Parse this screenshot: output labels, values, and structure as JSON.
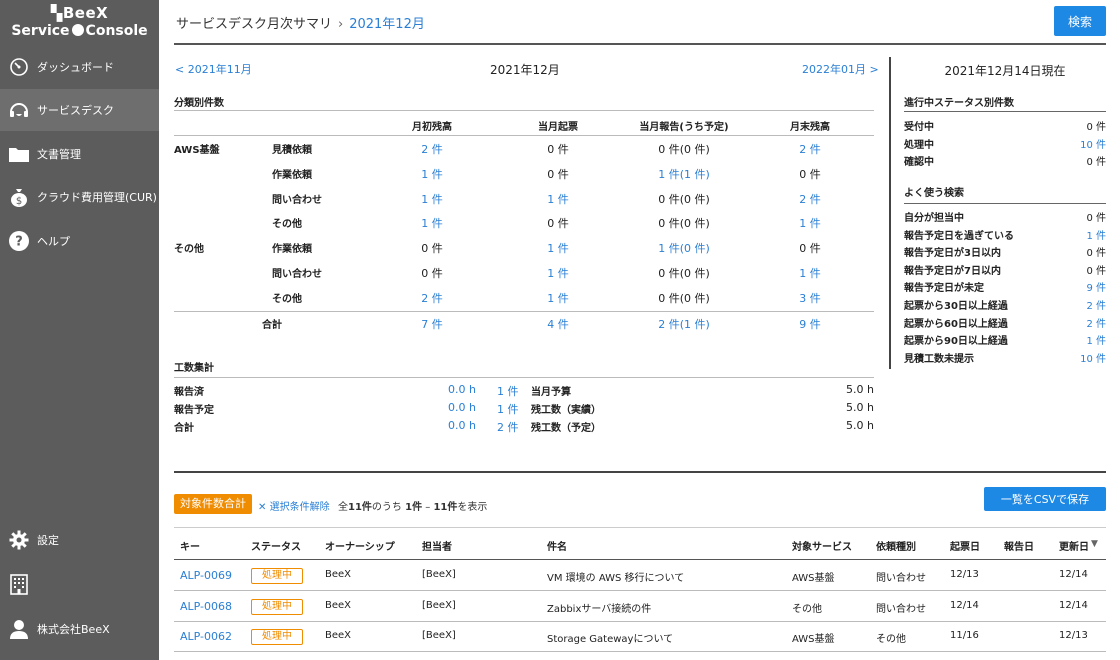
{
  "sidebar": {
    "logo_top": "BeeX",
    "logo_bottom_left": "Service",
    "logo_bottom_right": "Console",
    "items": [
      {
        "label": "ダッシュボード",
        "icon": "dashboard-gauge-icon"
      },
      {
        "label": "サービスデスク",
        "icon": "headset-icon"
      },
      {
        "label": "文書管理",
        "icon": "folder-icon"
      },
      {
        "label": "クラウド費用管理(CUR)",
        "icon": "money-bag-icon"
      },
      {
        "label": "ヘルプ",
        "icon": "help-icon"
      }
    ],
    "bottom_items": [
      {
        "label": "設定",
        "icon": "gear-icon"
      },
      {
        "label": "",
        "icon": "building-icon"
      },
      {
        "label": "株式会社BeeX",
        "icon": "user-icon"
      }
    ]
  },
  "header": {
    "breadcrumb_parent": "サービスデスク月次サマリ",
    "breadcrumb_current": "2021年12月",
    "search_button": "検索"
  },
  "month_nav": {
    "prev": "< 2021年11月",
    "current": "2021年12月",
    "next": "2022年01月 >"
  },
  "category": {
    "title": "分類別件数",
    "columns": [
      "月初残高",
      "当月起票",
      "当月報告(うち予定)",
      "月末残高"
    ],
    "rows": [
      {
        "group": "AWS基盤",
        "type": "見積依頼",
        "c1": "2 件",
        "c2": "0 件",
        "c3": "0 件(0 件)",
        "c4": "2 件"
      },
      {
        "group": "",
        "type": "作業依頼",
        "c1": "1 件",
        "c2": "0 件",
        "c3": "1 件(1 件)",
        "c4": "0 件"
      },
      {
        "group": "",
        "type": "問い合わせ",
        "c1": "1 件",
        "c2": "1 件",
        "c3": "0 件(0 件)",
        "c4": "2 件"
      },
      {
        "group": "",
        "type": "その他",
        "c1": "1 件",
        "c2": "0 件",
        "c3": "0 件(0 件)",
        "c4": "1 件"
      },
      {
        "group": "その他",
        "type": "作業依頼",
        "c1": "0 件",
        "c2": "1 件",
        "c3": "1 件(0 件)",
        "c4": "0 件"
      },
      {
        "group": "",
        "type": "問い合わせ",
        "c1": "0 件",
        "c2": "1 件",
        "c3": "0 件(0 件)",
        "c4": "1 件"
      },
      {
        "group": "",
        "type": "その他",
        "c1": "2 件",
        "c2": "1 件",
        "c3": "0 件(0 件)",
        "c4": "3 件"
      }
    ],
    "total": {
      "label": "合計",
      "c1": "7 件",
      "c2": "4 件",
      "c3": "2 件(1 件)",
      "c4": "9 件"
    }
  },
  "effort": {
    "title": "工数集計",
    "left_rows": [
      {
        "label": "報告済",
        "hours": "0.0 h",
        "count": "1 件"
      },
      {
        "label": "報告予定",
        "hours": "0.0 h",
        "count": "1 件"
      },
      {
        "label": "合計",
        "hours": "0.0 h",
        "count": "2 件"
      }
    ],
    "right_rows": [
      {
        "label": "当月予算",
        "value": "5.0 h"
      },
      {
        "label": "残工数（実績）",
        "value": "5.0 h"
      },
      {
        "label": "残工数（予定）",
        "value": "5.0 h"
      }
    ]
  },
  "right_panel": {
    "date": "2021年12月14日現在",
    "status_title": "進行中ステータス別件数",
    "status_rows": [
      {
        "label": "受付中",
        "value": "0 件",
        "link": false
      },
      {
        "label": "処理中",
        "value": "10 件",
        "link": true
      },
      {
        "label": "確認中",
        "value": "0 件",
        "link": false
      }
    ],
    "search_title": "よく使う検索",
    "search_rows": [
      {
        "label": "自分が担当中",
        "value": "0 件",
        "link": false
      },
      {
        "label": "報告予定日を過ぎている",
        "value": "1 件",
        "link": true
      },
      {
        "label": "報告予定日が3日以内",
        "value": "0 件",
        "link": false
      },
      {
        "label": "報告予定日が7日以内",
        "value": "0 件",
        "link": false
      },
      {
        "label": "報告予定日が未定",
        "value": "9 件",
        "link": true
      },
      {
        "label": "起票から30日以上経過",
        "value": "2 件",
        "link": true
      },
      {
        "label": "起票から60日以上経過",
        "value": "2 件",
        "link": true
      },
      {
        "label": "起票から90日以上経過",
        "value": "1 件",
        "link": true
      },
      {
        "label": "見積工数未提示",
        "value": "10 件",
        "link": true
      }
    ]
  },
  "list": {
    "total_badge": "対象件数合計",
    "clear_selection": "選択条件解除",
    "count_prefix": "全",
    "count_total": "11件",
    "count_mid": "のうち",
    "count_from": "1件",
    "count_dash": "–",
    "count_to": "11件",
    "count_suffix": "を表示",
    "csv_button": "一覧をCSVで保存",
    "columns": [
      "キー",
      "ステータス",
      "オーナーシップ",
      "担当者",
      "件名",
      "対象サービス",
      "依頼種別",
      "起票日",
      "報告日",
      "更新日"
    ],
    "sort_indicator": "▼",
    "rows": [
      {
        "key": "ALP-0069",
        "status": "処理中",
        "owner": "BeeX",
        "assignee": "[BeeX]",
        "subject": "VM 環境の AWS 移行について",
        "service": "AWS基盤",
        "type": "問い合わせ",
        "created": "12/13",
        "reported": "",
        "updated": "12/14"
      },
      {
        "key": "ALP-0068",
        "status": "処理中",
        "owner": "BeeX",
        "assignee": "[BeeX]",
        "subject": "Zabbixサーバ接続の件",
        "service": "その他",
        "type": "問い合わせ",
        "created": "12/14",
        "reported": "",
        "updated": "12/14"
      },
      {
        "key": "ALP-0062",
        "status": "処理中",
        "owner": "BeeX",
        "assignee": "[BeeX]",
        "subject": "Storage Gatewayについて",
        "service": "AWS基盤",
        "type": "その他",
        "created": "11/16",
        "reported": "",
        "updated": "12/13"
      }
    ]
  }
}
